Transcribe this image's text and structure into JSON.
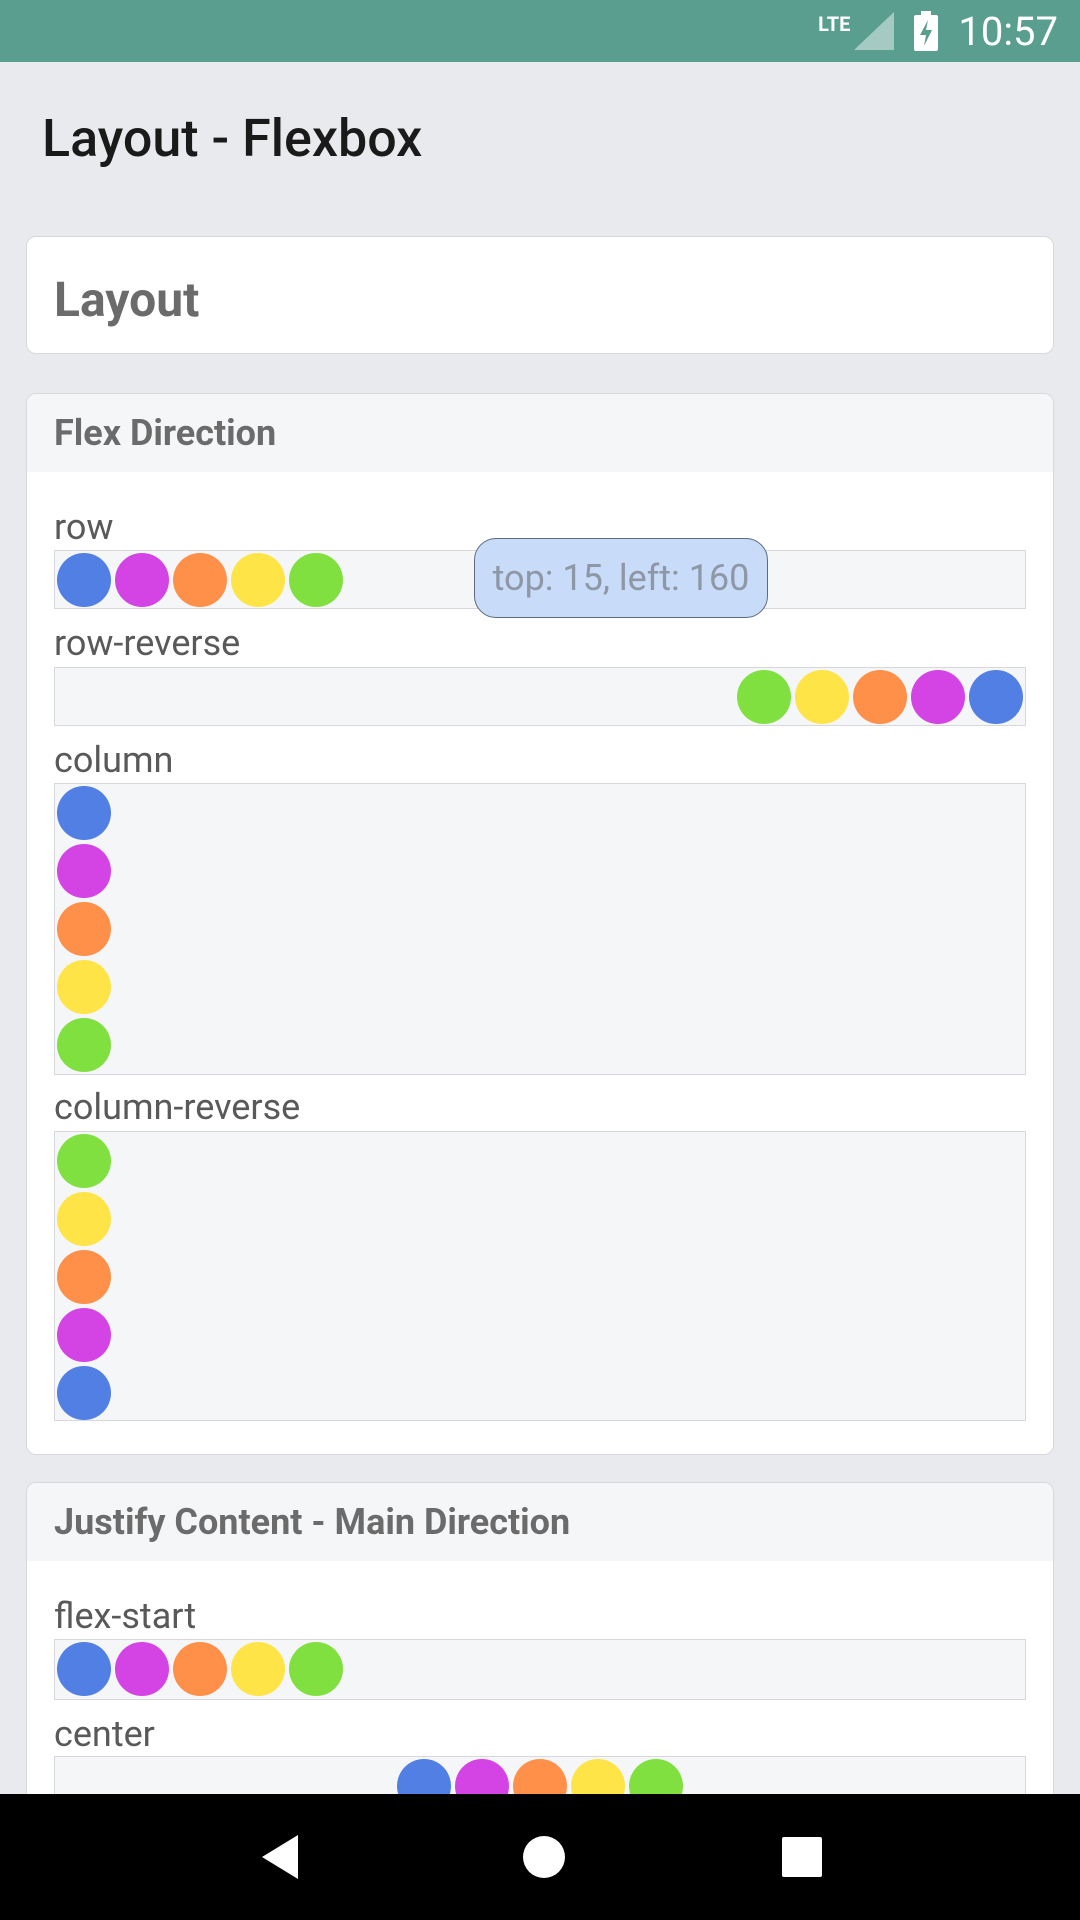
{
  "status_bar": {
    "network": "LTE",
    "time": "10:57",
    "icons": [
      "signal-icon",
      "battery-charging-icon"
    ]
  },
  "page": {
    "title": "Layout - Flexbox"
  },
  "layout_card": {
    "title": "Layout"
  },
  "flex_direction": {
    "header": "Flex Direction",
    "sections": [
      {
        "label": "row"
      },
      {
        "label": "row-reverse"
      },
      {
        "label": "column"
      },
      {
        "label": "column-reverse"
      }
    ]
  },
  "justify_content": {
    "header": "Justify Content - Main Direction",
    "sections": [
      {
        "label": "flex-start"
      },
      {
        "label": "center"
      }
    ]
  },
  "tooltip": {
    "text": "top: 15, left: 160"
  },
  "dot_colors": {
    "blue": "#527FE4",
    "magenta": "#D443E3",
    "orange": "#FF9049",
    "yellow": "#FEE446",
    "green": "#7FE040"
  },
  "nav_bar": {
    "icons": [
      "back-icon",
      "home-icon",
      "recents-icon"
    ]
  }
}
